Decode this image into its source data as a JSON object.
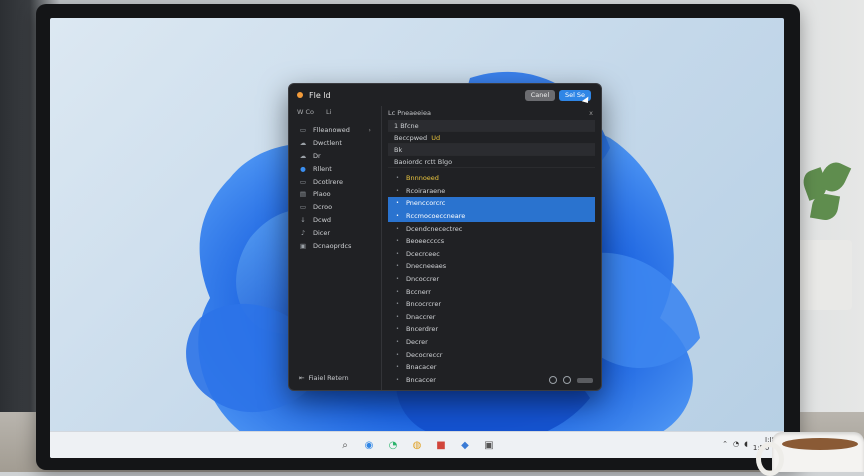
{
  "dialog": {
    "title": "Fle ld",
    "buttons": {
      "cancel": "Canel",
      "select": "Sel Se"
    },
    "sidebar": {
      "header_tabs": [
        "W Co",
        "Li"
      ],
      "items": [
        {
          "icon": "folder-icon",
          "label": "Flleanowed",
          "chev": "›"
        },
        {
          "icon": "cloud-icon",
          "label": "Dwctlent"
        },
        {
          "icon": "cloud-icon",
          "label": "Dr"
        },
        {
          "icon": "desktop-icon",
          "label": "Rllent"
        },
        {
          "icon": "folder-icon",
          "label": "Dcotlrere"
        },
        {
          "icon": "document-icon",
          "label": "Plaoo"
        },
        {
          "icon": "folder-icon",
          "label": "Dcroo"
        },
        {
          "icon": "download-icon",
          "label": "Dcwd"
        },
        {
          "icon": "music-icon",
          "label": "Dicer"
        },
        {
          "icon": "image-icon",
          "label": "Dcnaoprdcs"
        }
      ],
      "footer": "Fiaiel Retern"
    },
    "main": {
      "header": "Lc Pneaeeiea",
      "close": "x",
      "crumbs": [
        {
          "prefix": "1",
          "text": "1 Bfcne"
        },
        {
          "prefix": "a",
          "text": "Beccpwed",
          "gold": "Ud"
        },
        {
          "prefix": "b",
          "text": "Bk"
        },
        {
          "prefix": "b",
          "text": "Baoiordc rctt Blgo"
        }
      ],
      "rows": [
        {
          "label": "Bnnnoeed",
          "gold": true,
          "selected": false
        },
        {
          "label": "Rcoiraraene",
          "selected": false
        },
        {
          "label": "Pnenccorcrc",
          "selected": true
        },
        {
          "label": "Rccmocoeccneare",
          "selected": true
        },
        {
          "label": "Dcendcnecectrec",
          "selected": false
        },
        {
          "label": "Beoeeccccs",
          "selected": false
        },
        {
          "label": "Dcecrceec",
          "selected": false
        },
        {
          "label": "Dnecneeaes",
          "selected": false
        },
        {
          "label": "Dncoccrer",
          "selected": false
        },
        {
          "label": "Bccnerr",
          "selected": false
        },
        {
          "label": "Bncocrcrer",
          "selected": false
        },
        {
          "label": "Dnaccrer",
          "selected": false
        },
        {
          "label": "Bncerdrer",
          "selected": false
        },
        {
          "label": "Decrer",
          "selected": false
        },
        {
          "label": "Decocreccr",
          "selected": false
        },
        {
          "label": "Bnacacer",
          "selected": false
        },
        {
          "label": "Bncaccer",
          "selected": false
        }
      ]
    }
  },
  "taskbar": {
    "icons": [
      {
        "name": "search-icon",
        "glyph": "⌕",
        "color": "#4a4a4a"
      },
      {
        "name": "browser-icon",
        "glyph": "◉",
        "color": "#2f86e6"
      },
      {
        "name": "edge-icon",
        "glyph": "◔",
        "color": "#2bb36b"
      },
      {
        "name": "chrome-icon",
        "glyph": "◍",
        "color": "#e0a020"
      },
      {
        "name": "store-icon",
        "glyph": "■",
        "color": "#d1453b"
      },
      {
        "name": "settings-icon",
        "glyph": "◆",
        "color": "#3a7bd5"
      },
      {
        "name": "files-icon",
        "glyph": "▣",
        "color": "#555555"
      }
    ],
    "clock": {
      "time": "I:I8",
      "date": "1:N0 2"
    }
  }
}
